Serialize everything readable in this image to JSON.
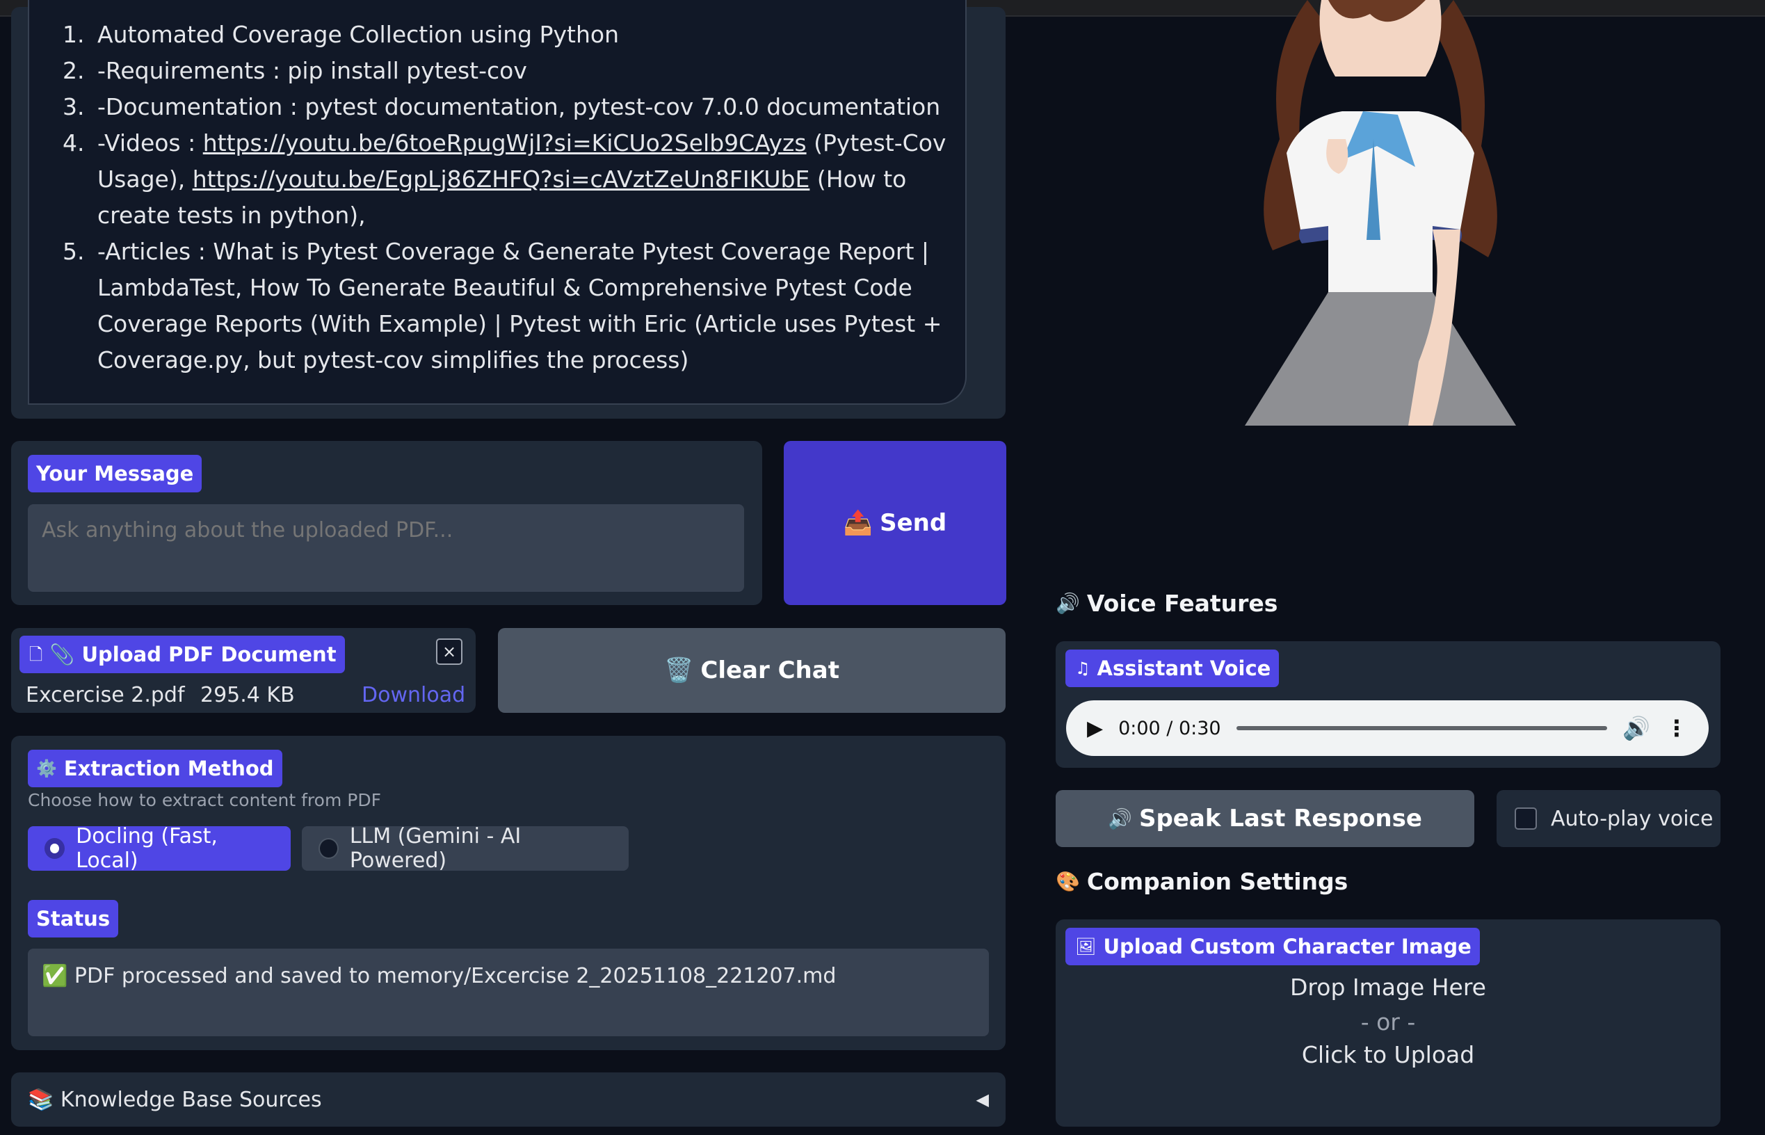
{
  "answer": {
    "items": [
      "Automated Coverage Collection using Python",
      "-Requirements : pip install pytest-cov",
      "-Documentation : pytest documentation, pytest-cov 7.0.0 documentation",
      {
        "prefix": "-Videos : ",
        "link1": "https://youtu.be/6toeRpugWjI?si=KiCUo2Selb9CAyzs",
        "mid": " (Pytest-Cov Usage), ",
        "link2": "https://youtu.be/EgpLj86ZHFQ?si=cAVztZeUn8FIKUbE",
        "suffix": " (How to create tests in python),"
      },
      "-Articles : What is Pytest Coverage & Generate Pytest Coverage Report | LambdaTest, How To Generate Beautiful & Comprehensive Pytest Code Coverage Reports (With Example) | Pytest with Eric (Article uses Pytest + Coverage.py, but pytest-cov simplifies the process)"
    ]
  },
  "message": {
    "label": "Your Message",
    "placeholder": "Ask anything about the uploaded PDF..."
  },
  "send": {
    "icon": "📤",
    "label": "Send"
  },
  "upload_pdf": {
    "label": "📎 Upload PDF Document",
    "file_name": "Excercise 2.pdf",
    "file_size": "295.4 KB",
    "download": "Download",
    "close": "×"
  },
  "clear": {
    "icon": "🗑️",
    "label": "Clear Chat"
  },
  "extraction": {
    "icon": "⚙️",
    "label": "Extraction Method",
    "description": "Choose how to extract content from PDF",
    "options": [
      {
        "label": "Docling (Fast, Local)",
        "selected": true
      },
      {
        "label": "LLM (Gemini - AI Powered)",
        "selected": false
      }
    ]
  },
  "status": {
    "label": "Status",
    "value": "✅ PDF processed and saved to memory/Excercise 2_20251108_221207.md"
  },
  "knowledge": {
    "icon": "📚",
    "label": "Knowledge Base Sources",
    "arrow": "◀"
  },
  "voice": {
    "title_icon": "🔊",
    "title": "Voice Features",
    "assistant_label": "Assistant Voice",
    "time": "0:00 / 0:30",
    "progress": 0.0,
    "speak_icon": "🔊",
    "speak_label": "Speak Last Response",
    "autoplay_label": "Auto-play voice",
    "autoplay_checked": false
  },
  "companion": {
    "title_icon": "🎨",
    "title": "Companion Settings",
    "upload_label": "Upload Custom Character Image",
    "drop": "Drop Image Here",
    "or": "- or -",
    "click": "Click to Upload"
  },
  "colors": {
    "background": "#0b0f19",
    "panel": "#1f2937",
    "accent": "#4f46e5",
    "send": "#4338ca",
    "link": "#6366f1"
  }
}
